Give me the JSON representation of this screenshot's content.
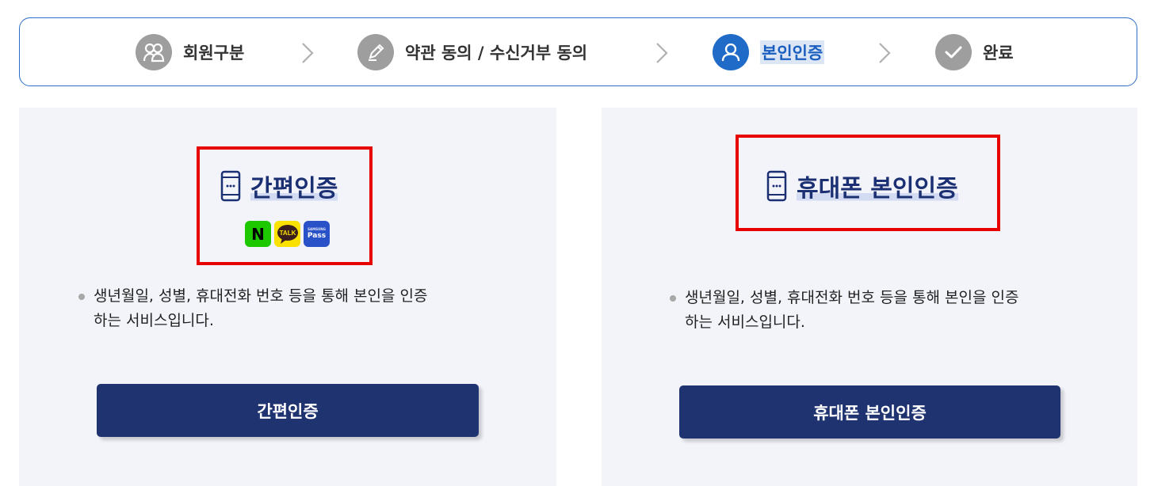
{
  "steps": [
    {
      "label": "회원구분",
      "icon": "members-icon",
      "state": "done"
    },
    {
      "label": "약관 동의 / 수신거부 동의",
      "icon": "pencil-icon",
      "state": "done"
    },
    {
      "label": "본인인증",
      "icon": "user-icon",
      "state": "active"
    },
    {
      "label": "완료",
      "icon": "check-icon",
      "state": "pending"
    }
  ],
  "colors": {
    "active": "#1f6bc7",
    "inactive": "#9e9e9e",
    "title": "#1b2f73",
    "button": "#1f3370",
    "highlight_box": "#e60000",
    "panel": "#f3f4fa"
  },
  "left_panel": {
    "title": "간편인증",
    "icon": "mobile-phone-icon",
    "brand_icons": {
      "naver": "N",
      "kakao": "TALK",
      "pass_small": "SAMSUNG",
      "pass": "Pass"
    },
    "description_line1": "생년월일, 성별, 휴대전화 번호 등을 통해 본인을 인증",
    "description_line2": "하는 서비스입니다.",
    "button": "간편인증"
  },
  "right_panel": {
    "title": "휴대폰 본인인증",
    "icon": "mobile-phone-icon",
    "description_line1": "생년월일, 성별, 휴대전화 번호 등을 통해 본인을 인증",
    "description_line2": "하는 서비스입니다.",
    "button": "휴대폰 본인인증"
  }
}
